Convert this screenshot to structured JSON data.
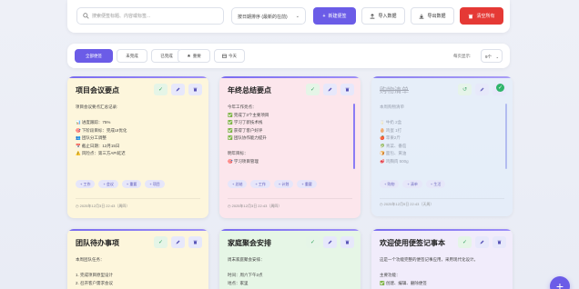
{
  "toolbar": {
    "search_placeholder": "搜索便签标题、内容或标签...",
    "sort_value": "按日期排序 (最新的在前)",
    "new_label": "新建便签",
    "import_label": "导入数据",
    "export_label": "导出数据",
    "clear_label": "清空所有"
  },
  "filters": {
    "items": [
      {
        "label": "全部便签"
      },
      {
        "label": "未完成"
      },
      {
        "label": "已完成"
      },
      {
        "label": "重要"
      },
      {
        "label": "今天"
      }
    ],
    "perpage_label": "每页显示:",
    "perpage_value": "9个"
  },
  "cards": [
    {
      "title": "项目会议要点",
      "lines": [
        "项目会议要点汇总记录:",
        "",
        "📊 进度跟踪：75%",
        "🎯 下阶段目标：完成UI优化",
        "👥 团队分工调整",
        "📅 截止日期：12月15日",
        "⚠️ 风险点：第三方API延迟"
      ],
      "tags": [
        "工作",
        "会议",
        "重要",
        "项目"
      ],
      "date": "2025年12月3日 22:43（周四）"
    },
    {
      "title": "年终总结要点",
      "lines": [
        "今年工作亮点：",
        "✅ 完成了3个主要项目",
        "✅ 学习了新技术栈",
        "✅ 获得了客户好评",
        "✅ 团队协作能力提升",
        "",
        "明年目标：",
        "🎯 学习项目管理"
      ],
      "tags": [
        "总结",
        "工作",
        "计划",
        "重要"
      ],
      "date": "2025年12月3日 22:43（周四）"
    },
    {
      "title": "购物清单",
      "lines": [
        "本周购物清单",
        "",
        "🥛 牛奶 2盒",
        "🥚 鸡蛋 1打",
        "🍎 苹果2斤",
        "🥬 青菜、番茄",
        "🍞 面包、黄油",
        "🥩 鸡胸肉 500g"
      ],
      "tags": [
        "购物",
        "清单",
        "生活"
      ],
      "date": "2025年12月9日 22:43（天周）"
    },
    {
      "title": "团队待办事项",
      "lines": [
        "本周团队任务：",
        "",
        "1. 完成项目原型设计",
        "2. 召开客户需求会议"
      ],
      "tags": [],
      "date": ""
    },
    {
      "title": "家庭聚会安排",
      "lines": [
        "周末家庭聚会安排：",
        "",
        "时间：周六下午2点",
        "地点：家里"
      ],
      "tags": [],
      "date": ""
    },
    {
      "title": "欢迎使用便签记事本",
      "lines": [
        "这是一个功能完整的便签记事应用，采用现代化设计。",
        "",
        "主要功能：",
        "✅ 创建、编辑、删除便签"
      ],
      "tags": [],
      "date": ""
    }
  ],
  "colors": {
    "accent": "#6b5ce7",
    "danger": "#e53935",
    "card_yellow": "#fdf6dc",
    "card_pink": "#fce6ec",
    "card_blue": "#e5eefa",
    "card_green": "#e6f6e6",
    "card_purple": "#f1ecfb"
  }
}
